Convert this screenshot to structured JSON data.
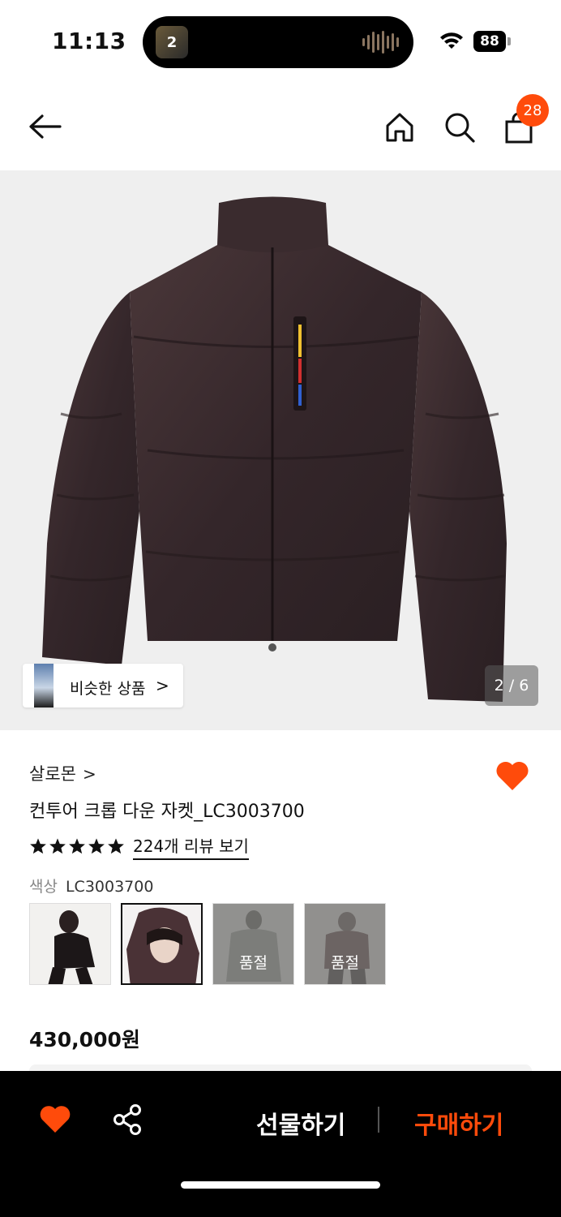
{
  "status_bar": {
    "time": "11:13",
    "island_app_badge": "2",
    "battery": "88",
    "icons": [
      "wifi-icon",
      "battery-icon",
      "audio-wave-icon"
    ]
  },
  "nav": {
    "icons": [
      "back-arrow-icon",
      "home-icon",
      "search-icon",
      "shopping-bag-icon"
    ],
    "cart_count": "28"
  },
  "gallery": {
    "similar_label": "비슷한 상품",
    "similar_chevron": ">",
    "page_indicator": "2 / 6"
  },
  "product": {
    "brand": "살로몬",
    "brand_chevron": ">",
    "name": "컨투어 크롭 다운 자켓_LC3003700",
    "rating": 5,
    "review_link": "224개 리뷰 보기",
    "color_label": "색상",
    "color_value": "LC3003700",
    "swatches": [
      {
        "selected": false,
        "sold_out": false,
        "sold_out_label": ""
      },
      {
        "selected": true,
        "sold_out": false,
        "sold_out_label": ""
      },
      {
        "selected": false,
        "sold_out": true,
        "sold_out_label": "품절"
      },
      {
        "selected": false,
        "sold_out": true,
        "sold_out_label": "품절"
      }
    ],
    "price": "430,000원",
    "wishlisted": true
  },
  "bottom_bar": {
    "gift_label": "선물하기",
    "buy_label": "구매하기",
    "icons": [
      "heart-icon",
      "share-icon"
    ]
  },
  "colors": {
    "accent": "#ff4b0b",
    "bottom_bar_bg": "#000000",
    "jacket": "#3b2b2d"
  }
}
